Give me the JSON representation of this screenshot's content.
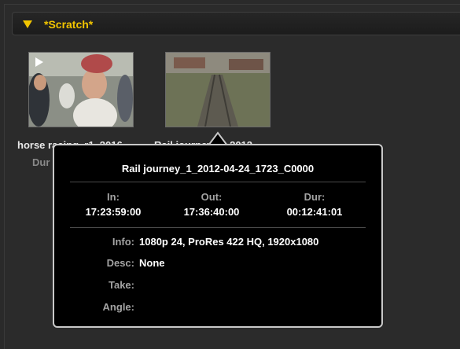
{
  "bin": {
    "title": "*Scratch*"
  },
  "clips": [
    {
      "name": "horse racing_r1_2016",
      "duration_label": "Dur"
    },
    {
      "name": "Rail journey_1_2012"
    }
  ],
  "popup": {
    "title": "Rail journey_1_2012-04-24_1723_C0000",
    "in_label": "In:",
    "in_value": "17:23:59:00",
    "out_label": "Out:",
    "out_value": "17:36:40:00",
    "dur_label": "Dur:",
    "dur_value": "00:12:41:01",
    "info_label": "Info:",
    "info_value": "1080p 24, ProRes 422 HQ, 1920x1080",
    "desc_label": "Desc:",
    "desc_value": "None",
    "take_label": "Take:",
    "take_value": "",
    "angle_label": "Angle:",
    "angle_value": ""
  },
  "icons": [
    "disclosure-triangle-icon",
    "play-icon"
  ],
  "colors": {
    "accent": "#f2c500",
    "background": "#2b2b2b",
    "popup_bg": "#000000",
    "popup_border": "#c9c9c9"
  }
}
